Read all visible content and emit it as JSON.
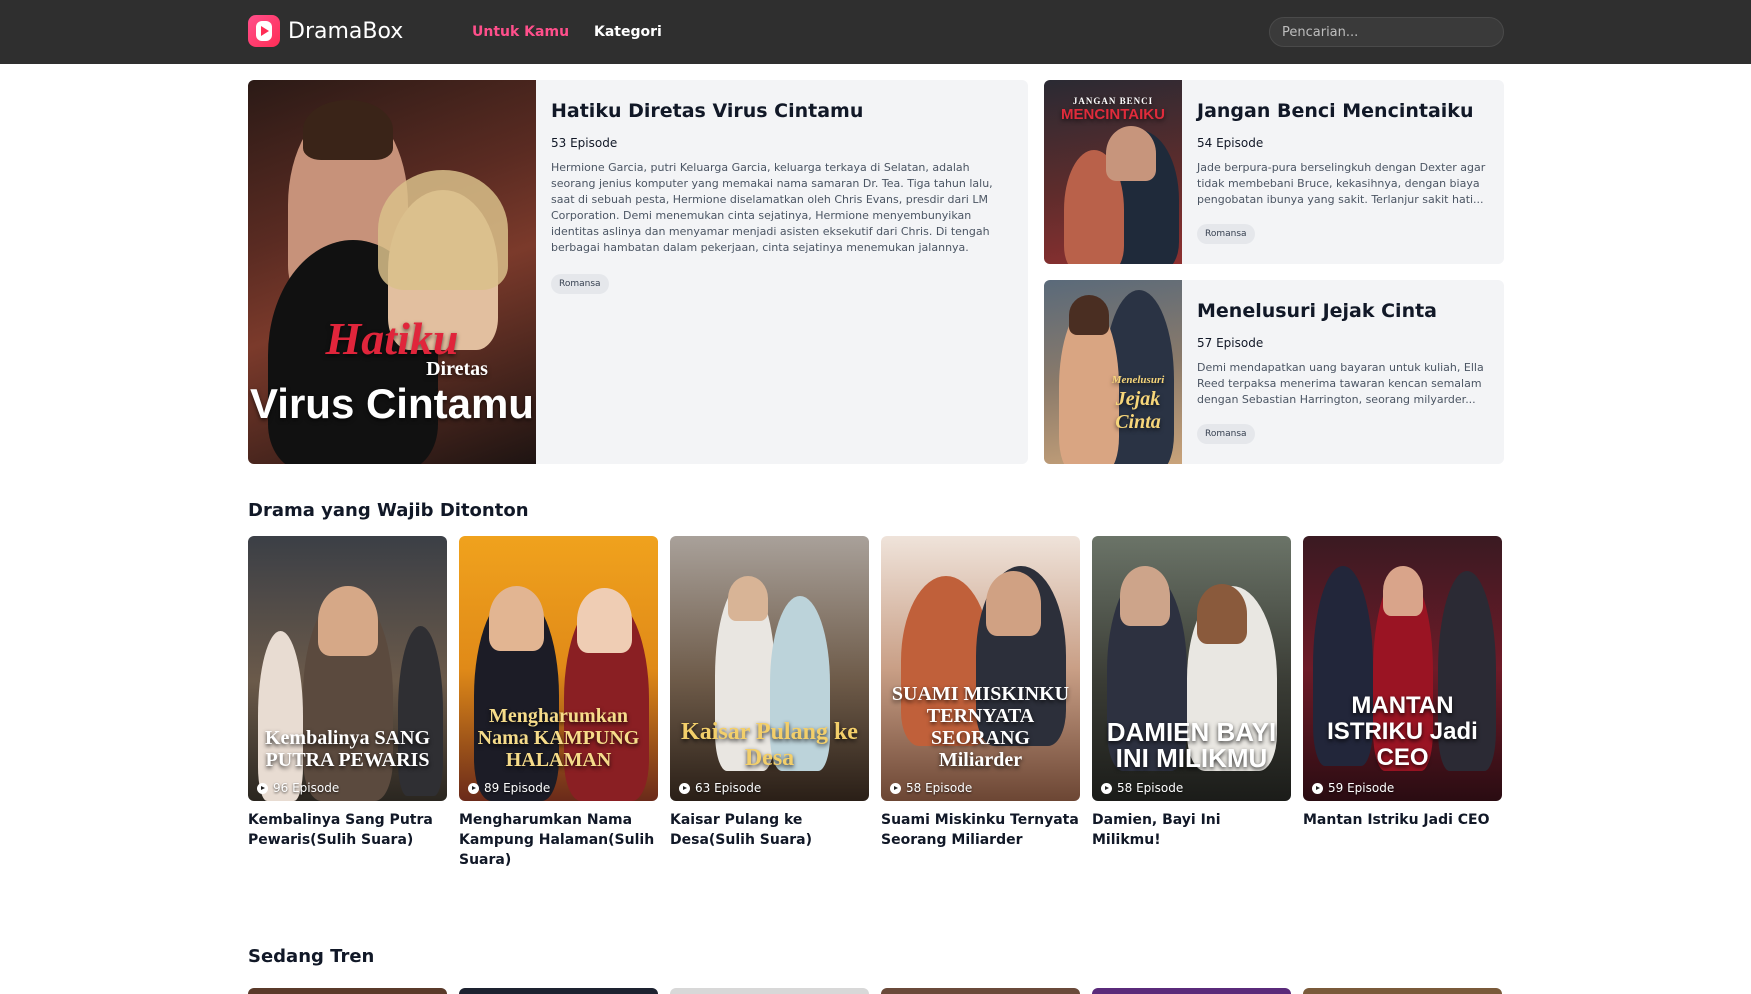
{
  "header": {
    "brand": "DramaBox",
    "nav": [
      {
        "label": "Untuk Kamu",
        "active": true
      },
      {
        "label": "Kategori",
        "active": false
      }
    ],
    "search_placeholder": "Pencarian..."
  },
  "featured": {
    "main": {
      "title": "Hatiku Diretas Virus Cintamu",
      "episodes": "53 Episode",
      "description": "Hermione Garcia, putri Keluarga Garcia, keluarga terkaya di Selatan, adalah seorang jenius komputer yang memakai nama samaran Dr. Tea. Tiga tahun lalu, saat di sebuah pesta, Hermione diselamatkan oleh Chris Evans, presdir dari LM Corporation. Demi menemukan cinta sejatinya, Hermione menyembunyikan identitas aslinya dan menyamar menjadi asisten eksekutif dari Chris. Di tengah berbagai hambatan dalam pekerjaan, cinta sejatinya menemukan jalannya.",
      "tag": "Romansa",
      "poster_text": {
        "line1": "Hatiku",
        "line2": "Diretas",
        "line3": "Virus Cintamu"
      }
    },
    "side": [
      {
        "title": "Jangan Benci Mencintaiku",
        "episodes": "54 Episode",
        "description": "Jade berpura-pura berselingkuh dengan Dexter agar tidak membebani Bruce, kekasihnya, dengan biaya pengobatan ibunya yang sakit. Terlanjur sakit hati...",
        "tag": "Romansa",
        "poster_text": {
          "line1": "JANGAN BENCI",
          "line2": "MENCINTAIKU"
        }
      },
      {
        "title": "Menelusuri Jejak Cinta",
        "episodes": "57 Episode",
        "description": "Demi mendapatkan uang bayaran untuk kuliah, Ella Reed terpaksa menerima tawaran kencan semalam dengan Sebastian Harrington, seorang milyarder...",
        "tag": "Romansa",
        "poster_text": {
          "line1": "Menelusuri",
          "line2": "Jejak Cinta"
        }
      }
    ]
  },
  "sections": {
    "must_watch": {
      "title": "Drama yang Wajib Ditonton",
      "items": [
        {
          "title": "Kembalinya Sang Putra Pewaris(Sulih Suara)",
          "episodes": "96 Episode",
          "poster_text": "Kembalinya SANG PUTRA PEWARIS"
        },
        {
          "title": "Mengharumkan Nama Kampung Halaman(Sulih Suara)",
          "episodes": "89 Episode",
          "poster_text": "Mengharumkan Nama KAMPUNG HALAMAN"
        },
        {
          "title": "Kaisar Pulang ke Desa(Sulih Suara)",
          "episodes": "63 Episode",
          "poster_text": "Kaisar Pulang ke Desa"
        },
        {
          "title": "Suami Miskinku Ternyata Seorang Miliarder",
          "episodes": "58 Episode",
          "poster_text": "SUAMI MISKINKU TERNYATA SEORANG Miliarder"
        },
        {
          "title": "Damien, Bayi Ini Milikmu!",
          "episodes": "58 Episode",
          "poster_text": "DAMIEN BAYI INI MILIKMU"
        },
        {
          "title": "Mantan Istriku Jadi CEO",
          "episodes": "59 Episode",
          "poster_text": "MANTAN ISTRIKU Jadi CEO"
        }
      ]
    },
    "trending": {
      "title": "Sedang Tren"
    }
  },
  "colors": {
    "accent": "#ff4f8b",
    "header_bg": "#2f2f2f",
    "card_bg": "#f3f4f6"
  },
  "icons": {
    "logo": "dramabox-logo-icon",
    "episode": "play-circle-icon"
  }
}
